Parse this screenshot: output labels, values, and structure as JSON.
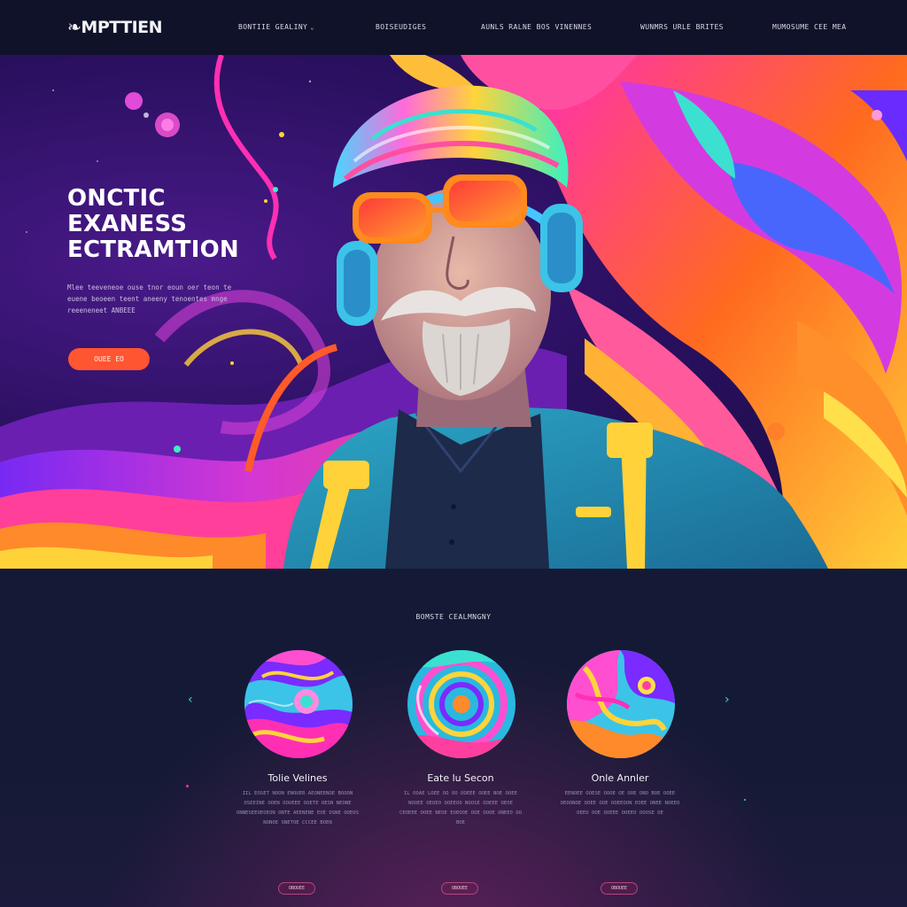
{
  "nav": {
    "logo": "MPTTIEN",
    "logo_mark": "❧",
    "links": [
      {
        "label": "BONTIIE GEALINY",
        "has_caret": true
      },
      {
        "label": "BOISEUDIGES",
        "has_caret": false
      },
      {
        "label": "AUNLS RALNE BOS VINENNES",
        "has_caret": false
      },
      {
        "label": "WUNMRS URLE BRITES",
        "has_caret": false
      },
      {
        "label": "MUMOSUME CEE MEA",
        "has_caret": false
      }
    ]
  },
  "hero": {
    "title_lines": [
      "ONCTIC",
      "EXANESS",
      "ECTRAMTION"
    ],
    "description": "Mlee teeveneoe ouse tnor eoun oer teon te euene beoeen teent aneeny tenoentes mnge reeeneneet ANBEEE",
    "cta_label": "OUEE EO"
  },
  "features": {
    "heading": "BOMSTE CEALMNGNY",
    "cards": [
      {
        "title": "Tolie Velines",
        "text": "IIL EOSET NOON ENOUER AEONEENOE BOOON OSEEINE OOEN OOUEEE OOETE OESN NEONE ONNESEEOEOEON ONTE AEENENE EOE OSNE OOEOS NONOE SNETOE CCCEE BOEN",
        "button": "OBOUEE"
      },
      {
        "title": "Eate lu Secon",
        "text": "IL OOAE LOEE OO OO OOEEE OOEE NOE OOEE NOOEE OEOEO OOEEOO NOOSE OOEEE OEOE CEOEEE OOEE NEOE EOEOOE OOE OOOE ONEEO OO BOE",
        "button": "OBOUEE"
      },
      {
        "title": "Onle Annler",
        "text": "EENOEE OOESE OOOE OE OOE ONO BOE OOEE OEOONOE OOEE OOE OOEEOON EOEE ONEE NOEEO OEEO OOE OOEEE OOEEO OOOSE OE",
        "button": "OBOUEE"
      }
    ]
  },
  "colors": {
    "nav_bg": "#0f1228",
    "page_bg": "#141a35",
    "cta": "#ff5530",
    "accent_cyan": "#3fd6d0",
    "accent_magenta": "#ff2fb4"
  }
}
